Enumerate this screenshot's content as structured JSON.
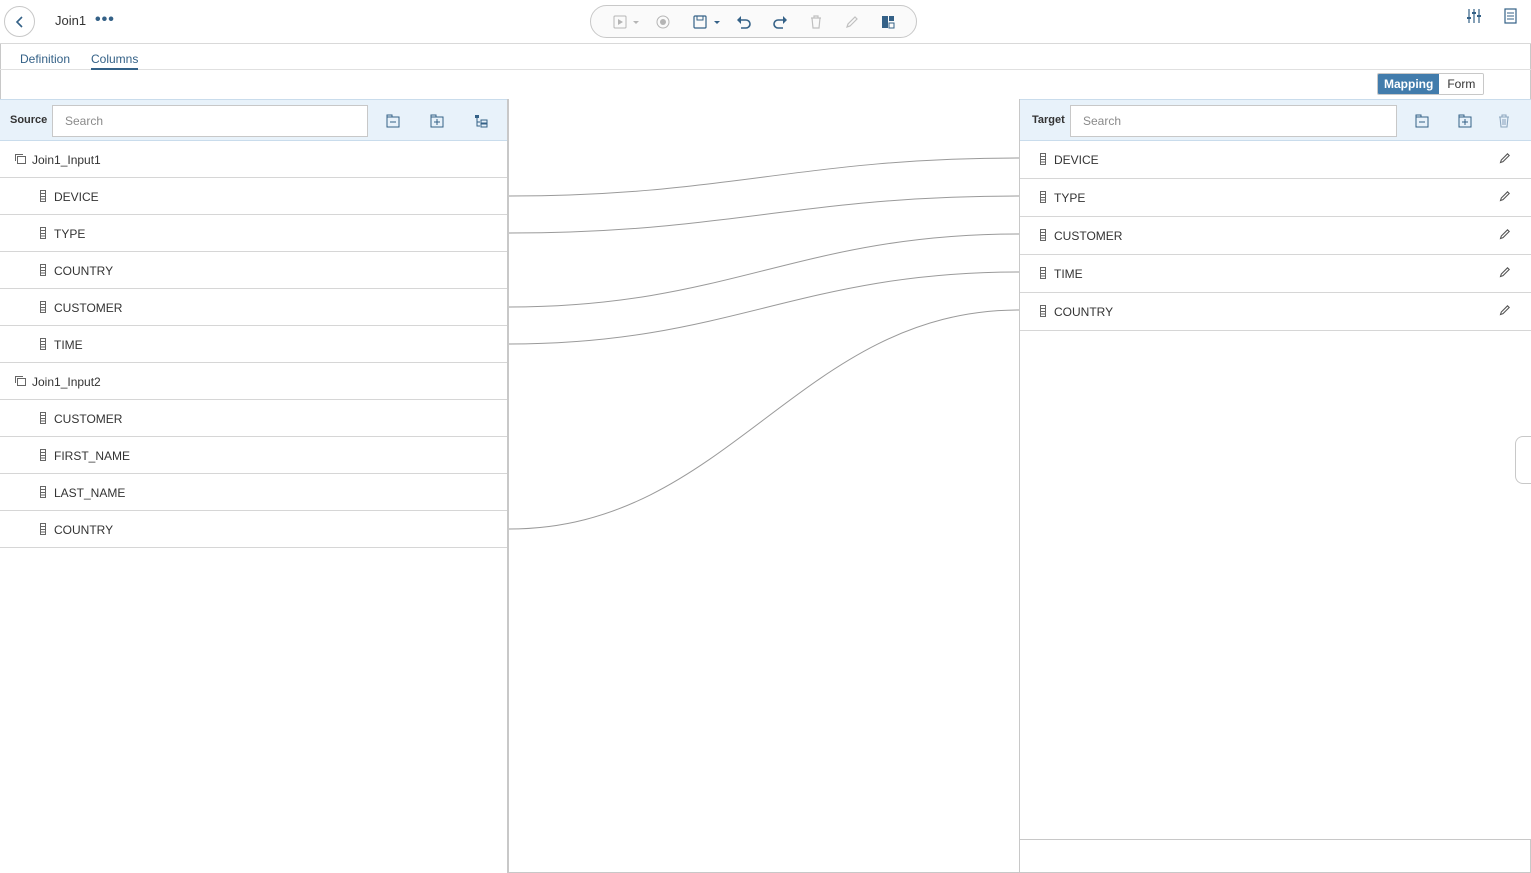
{
  "app": {
    "title": "Join1"
  },
  "toolbar": {
    "icons": [
      "run-icon",
      "stop-icon",
      "save-icon",
      "undo-icon",
      "redo-icon",
      "delete-icon",
      "edit-icon",
      "layout-icon"
    ]
  },
  "tabs": [
    {
      "label": "Definition",
      "active": false
    },
    {
      "label": "Columns",
      "active": true
    }
  ],
  "view_toggle": {
    "options": [
      "Mapping",
      "Form"
    ],
    "selected": "Mapping"
  },
  "source": {
    "label": "Source",
    "search_placeholder": "Search",
    "groups": [
      {
        "name": "Join1_Input1",
        "columns": [
          "DEVICE",
          "TYPE",
          "COUNTRY",
          "CUSTOMER",
          "TIME"
        ]
      },
      {
        "name": "Join1_Input2",
        "columns": [
          "CUSTOMER",
          "FIRST_NAME",
          "LAST_NAME",
          "COUNTRY"
        ]
      }
    ]
  },
  "target": {
    "label": "Target",
    "search_placeholder": "Search",
    "columns": [
      "DEVICE",
      "TYPE",
      "CUSTOMER",
      "TIME",
      "COUNTRY"
    ]
  },
  "mappings": [
    {
      "source": "Join1_Input1.DEVICE",
      "target": "DEVICE"
    },
    {
      "source": "Join1_Input1.TYPE",
      "target": "TYPE"
    },
    {
      "source": "Join1_Input1.CUSTOMER",
      "target": "CUSTOMER"
    },
    {
      "source": "Join1_Input1.TIME",
      "target": "TIME"
    },
    {
      "source": "Join1_Input2.COUNTRY",
      "target": "COUNTRY"
    }
  ],
  "colors": {
    "accent": "#427cac",
    "header_bg": "#e8f2fa",
    "link": "#346187"
  }
}
